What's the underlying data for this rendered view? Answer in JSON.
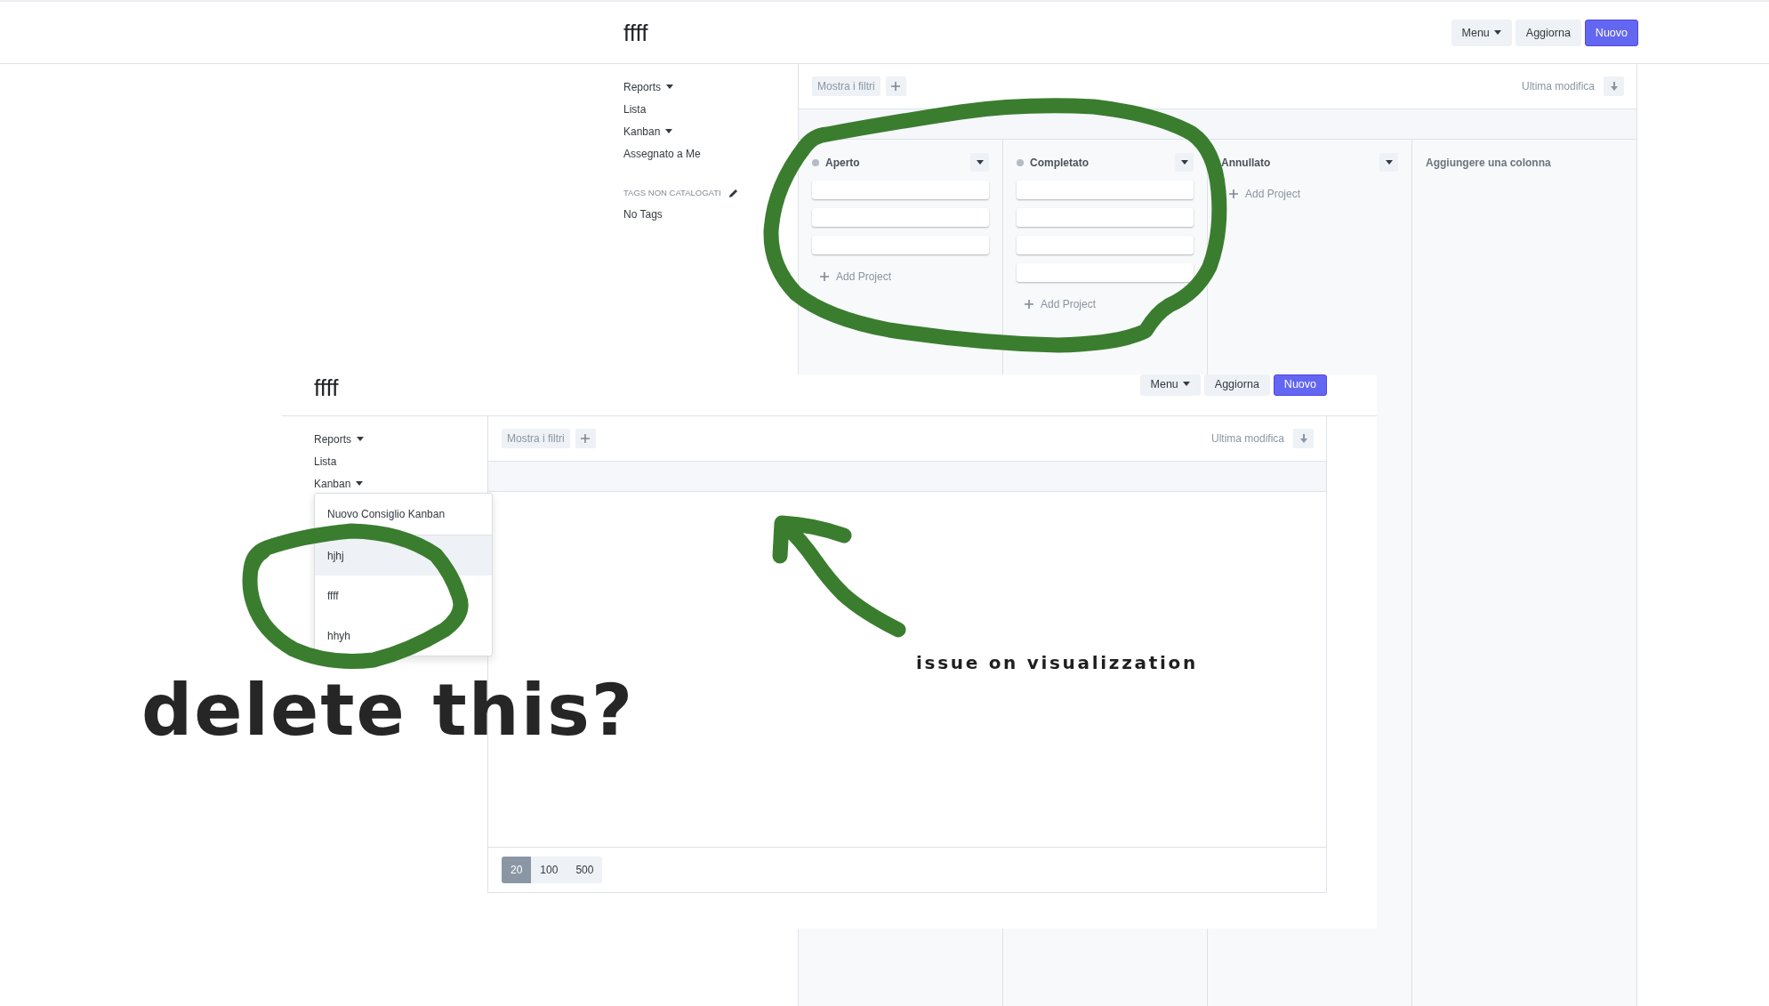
{
  "back_screen": {
    "header": {
      "title": "ffff",
      "buttons": [
        {
          "label": "Menu",
          "kind": "menu"
        },
        {
          "label": "Aggiorna",
          "kind": "plain"
        },
        {
          "label": "Nuovo",
          "kind": "primary"
        }
      ]
    },
    "sidebar": {
      "items": [
        {
          "label": "Reports",
          "has_menu": true
        },
        {
          "label": "Lista",
          "has_menu": false
        },
        {
          "label": "Kanban",
          "has_menu": true
        },
        {
          "label": "Assegnato a Me",
          "has_menu": false
        }
      ],
      "tags_heading": "TAGS NON CATALOGATI",
      "tags_empty": "No Tags"
    },
    "toolbar": {
      "filter_button": "Mostra i filtri",
      "sort_label": "Ultima modifica"
    },
    "columns": [
      {
        "kind": "stage",
        "title": "Aperto",
        "status_dot": true,
        "cards": [
          {
            "kind": "blank"
          },
          {
            "kind": "blank"
          },
          {
            "kind": "blank"
          }
        ],
        "add_label": "Add Project"
      },
      {
        "kind": "stage",
        "title": "Completato",
        "status_dot": true,
        "cards": [
          {
            "kind": "blank"
          },
          {
            "kind": "blank"
          },
          {
            "kind": "blank"
          },
          {
            "kind": "blank"
          }
        ],
        "add_label": "Add Project"
      },
      {
        "kind": "stage",
        "title": "Annullato",
        "status_dot": false,
        "add_label": "Add Project"
      },
      {
        "kind": "add_column",
        "title": "Aggiungere una colonna"
      }
    ]
  },
  "front_screen": {
    "header": {
      "title": "ffff",
      "buttons": [
        {
          "label": "Menu",
          "kind": "menu"
        },
        {
          "label": "Aggiorna",
          "kind": "plain"
        },
        {
          "label": "Nuovo",
          "kind": "primary"
        }
      ]
    },
    "sidebar": {
      "items": [
        {
          "label": "Reports",
          "has_menu": true
        },
        {
          "label": "Lista",
          "has_menu": false
        },
        {
          "label": "Kanban",
          "has_menu": true,
          "dropdown": [
            {
              "label": "Nuovo Consiglio Kanban",
              "kind": "action",
              "selected": false
            },
            {
              "label": "hjhj",
              "kind": "board",
              "selected": true
            },
            {
              "label": "ffff",
              "kind": "board",
              "selected": false
            },
            {
              "label": "hhyh",
              "kind": "board",
              "selected": false
            }
          ]
        }
      ]
    },
    "toolbar": {
      "filter_button": "Mostra i filtri",
      "sort_label": "Ultima modifica"
    },
    "page_sizes": [
      {
        "label": "20",
        "selected": true
      },
      {
        "label": "100",
        "selected": false
      },
      {
        "label": "500",
        "selected": false
      }
    ]
  },
  "annotations": [
    {
      "kind": "caption",
      "text": "issue on visualizzation"
    },
    {
      "kind": "question",
      "text": "delete this?"
    }
  ]
}
